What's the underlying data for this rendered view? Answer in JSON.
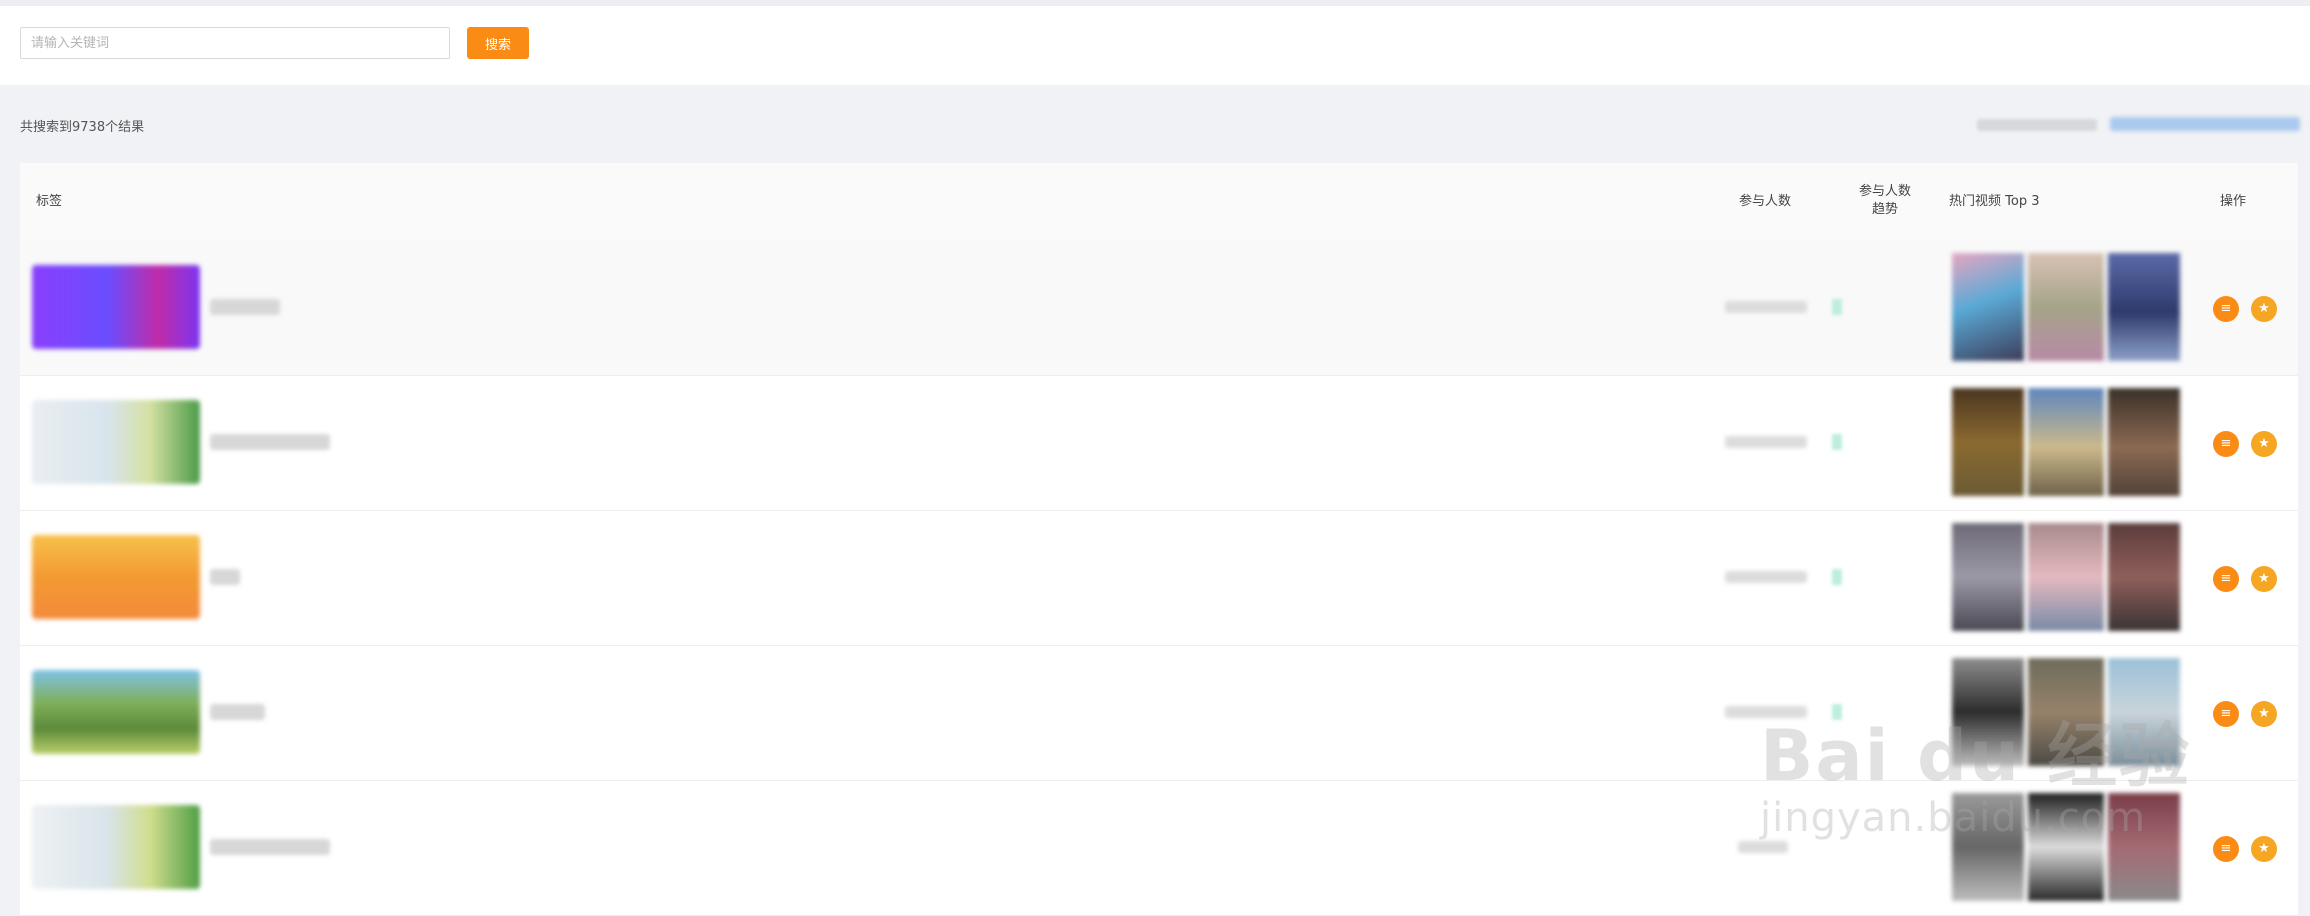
{
  "search": {
    "placeholder": "请输入关键词",
    "button_label": "搜索"
  },
  "results": {
    "count_text": "共搜索到9738个结果"
  },
  "table": {
    "columns": {
      "tag": "标签",
      "participants": "参与人数",
      "trend_line1": "参与人数",
      "trend_line2": "趋势",
      "hot_videos": "热门视频 Top 3",
      "actions": "操作"
    },
    "row_actions": {
      "detail_icon": "list-icon",
      "favorite_icon": "star-icon"
    }
  },
  "watermark": {
    "main": "Bai du 经验",
    "sub": "jingyan.baidu.com"
  }
}
